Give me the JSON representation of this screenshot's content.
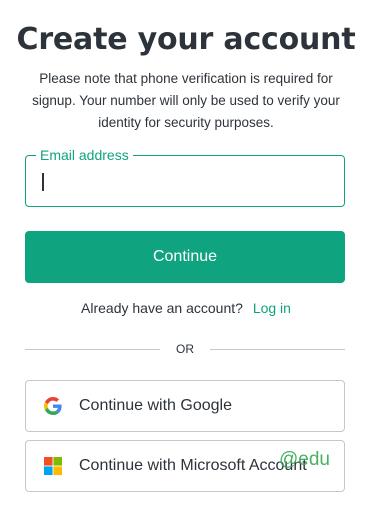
{
  "header": {
    "title": "Create your account",
    "subtitle": "Please note that phone verification is required for signup. Your number will only be used to verify your identity for security purposes."
  },
  "email": {
    "label": "Email address",
    "value": ""
  },
  "actions": {
    "continue_label": "Continue"
  },
  "login": {
    "prompt": "Already have an account?",
    "link": "Log in"
  },
  "divider": {
    "text": "OR"
  },
  "social": {
    "google_label": "Continue with Google",
    "microsoft_label": "Continue with Microsoft Account",
    "google_icon": "google-icon",
    "microsoft_icon": "microsoft-icon"
  },
  "watermark": {
    "text": "@edu"
  },
  "colors": {
    "accent": "#10a37f",
    "text": "#2d333a",
    "border": "#c2c8d0"
  }
}
